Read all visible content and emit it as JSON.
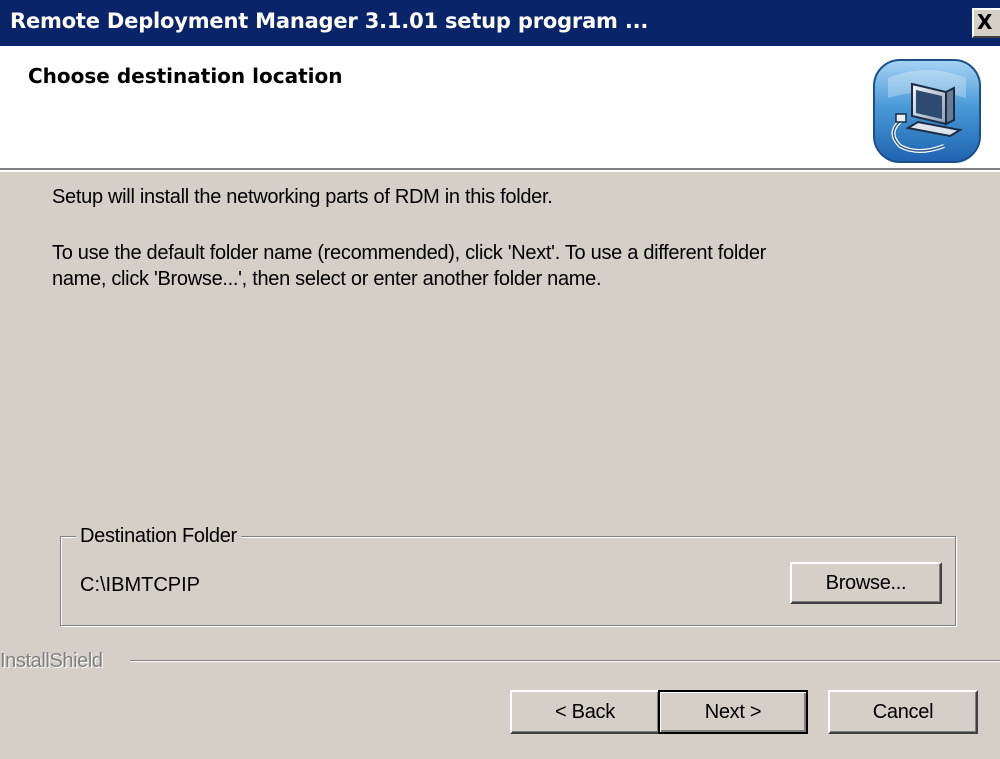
{
  "window": {
    "title": "Remote Deployment Manager 3.1.01 setup program ...",
    "close_glyph": "X"
  },
  "header": {
    "title": "Choose destination location",
    "icon": "setup-computer-icon"
  },
  "body": {
    "line1": "Setup will install the networking parts of RDM in this folder.",
    "line2": "To use the default folder name (recommended), click 'Next'.  To use a different folder",
    "line3": "name, click 'Browse...', then select or enter another folder name."
  },
  "destination": {
    "group_label": "Destination Folder",
    "path": "C:\\IBMTCPIP",
    "browse_label": "Browse..."
  },
  "footer": {
    "brand": "InstallShield",
    "back_label": "< Back",
    "next_label": "Next >",
    "cancel_label": "Cancel"
  },
  "colors": {
    "titlebar": "#0a246a",
    "dialog_face": "#d4d0c8",
    "header_bg": "#ffffff"
  }
}
